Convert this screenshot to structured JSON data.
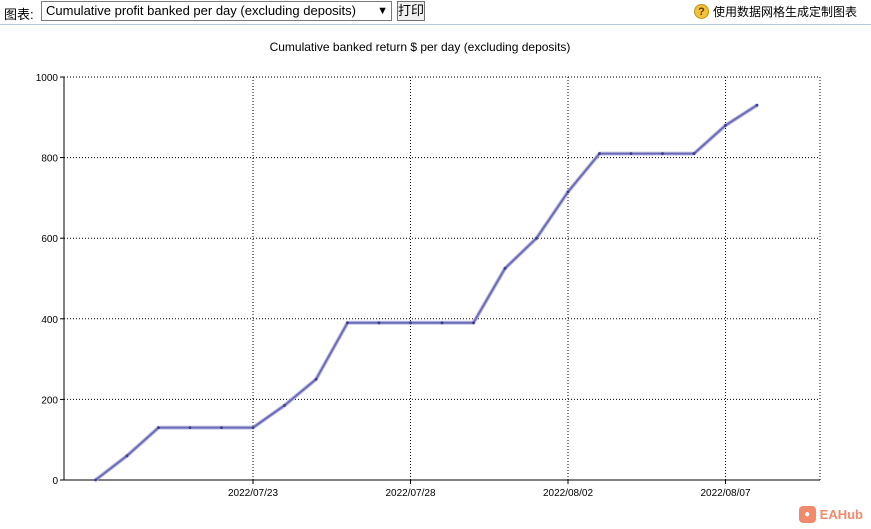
{
  "toolbar": {
    "chart_label": "图表:",
    "selected_chart": "Cumulative profit banked per day (excluding deposits)",
    "print_label": "打印",
    "help_text": "使用数据网格生成定制图表"
  },
  "watermark": {
    "text": "EAHub"
  },
  "colors": {
    "line": "#6b6bb8",
    "marker": "#3d3d8a",
    "grid": "#000000"
  },
  "chart_data": {
    "type": "line",
    "title": "Cumulative banked return $ per day (excluding deposits)",
    "xlabel": "",
    "ylabel": "",
    "ylim": [
      0,
      1000
    ],
    "yticks": [
      0,
      200,
      400,
      600,
      800,
      1000
    ],
    "xlim": [
      "2022/07/17",
      "2022/08/10"
    ],
    "xticks": [
      "2022/07/23",
      "2022/07/28",
      "2022/08/02",
      "2022/08/07"
    ],
    "grid": true,
    "series": [
      {
        "x": [
          "2022/07/18",
          "2022/07/19",
          "2022/07/20",
          "2022/07/21",
          "2022/07/22",
          "2022/07/23",
          "2022/07/24",
          "2022/07/25",
          "2022/07/26",
          "2022/07/27",
          "2022/07/28",
          "2022/07/29",
          "2022/07/30",
          "2022/07/31",
          "2022/08/01",
          "2022/08/02",
          "2022/08/03",
          "2022/08/04",
          "2022/08/05",
          "2022/08/06",
          "2022/08/07",
          "2022/08/08",
          "2022/08/09"
        ],
        "values": [
          0,
          60,
          130,
          130,
          130,
          130,
          185,
          250,
          390,
          390,
          390,
          390,
          390,
          525,
          600,
          715,
          810,
          810,
          810,
          810,
          880,
          930,
          null
        ]
      }
    ]
  }
}
